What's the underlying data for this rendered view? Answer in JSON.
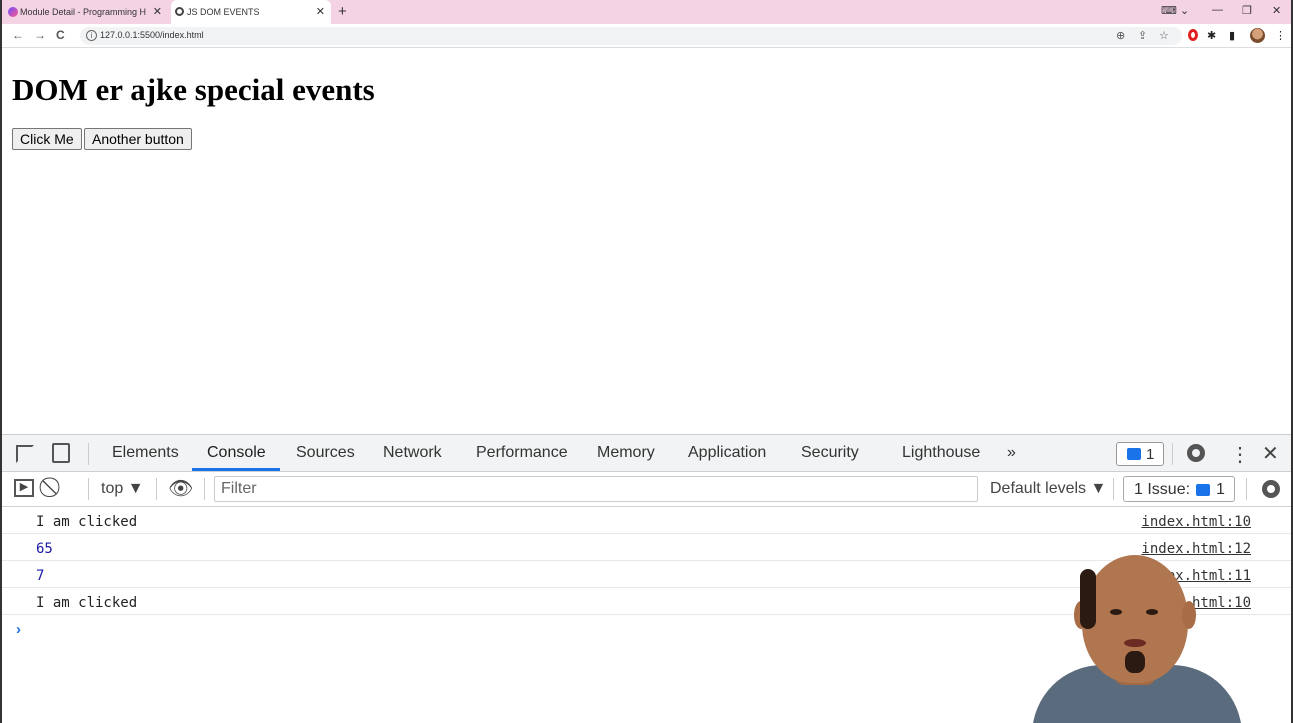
{
  "browser": {
    "tabs": [
      {
        "title": "Module Detail - Programming H",
        "active": false
      },
      {
        "title": "JS DOM EVENTS",
        "active": true
      }
    ],
    "url": "127.0.0.1:5500/index.html",
    "icons": [
      "back-icon",
      "forward-icon",
      "reload-icon",
      "info-icon",
      "zoom-icon",
      "share-icon",
      "star-icon",
      "opera-icon",
      "extensions-icon",
      "sidepanel-icon",
      "profile-avatar",
      "menu-icon"
    ]
  },
  "page": {
    "heading": "DOM er ajke special events",
    "buttons": [
      "Click Me",
      "Another button"
    ]
  },
  "devtools": {
    "tabs": [
      "Elements",
      "Console",
      "Sources",
      "Network",
      "Performance",
      "Memory",
      "Application",
      "Security",
      "Lighthouse"
    ],
    "active_tab": "Console",
    "more_tabs": "»",
    "messages_count": "1",
    "context": "top",
    "filter_placeholder": "Filter",
    "levels": "Default levels",
    "issues_label": "1 Issue:",
    "issues_count": "1",
    "accent": "#1a73e8",
    "console": [
      {
        "text": "I am clicked",
        "source": "index.html:10",
        "type": "string"
      },
      {
        "text": "65",
        "source": "index.html:12",
        "type": "number"
      },
      {
        "text": "7",
        "source": "index.html:11",
        "type": "number"
      },
      {
        "text": "I am clicked",
        "source": "index.html:10",
        "type": "string"
      }
    ],
    "prompt": "›"
  }
}
